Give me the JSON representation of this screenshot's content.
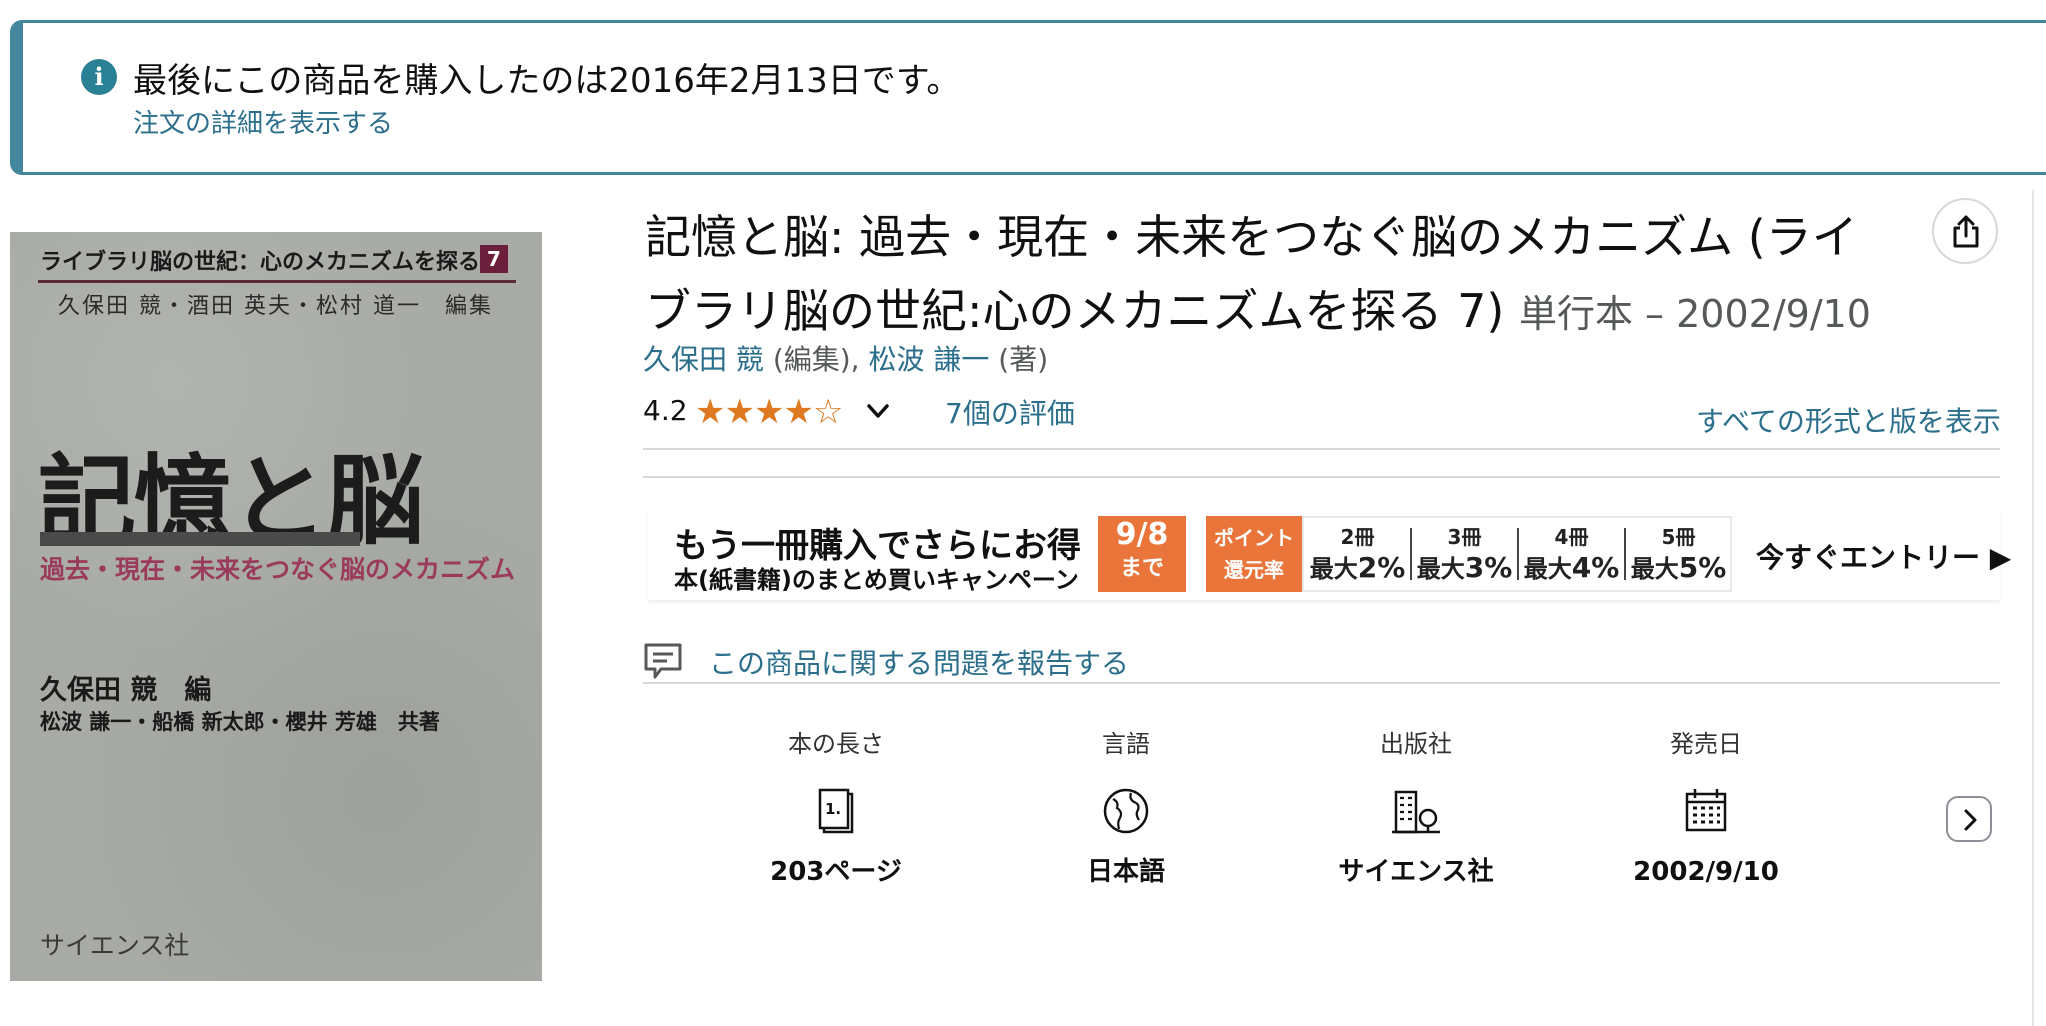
{
  "notice": {
    "icon": "info-icon",
    "message": "最後にこの商品を購入したのは2016年2月13日です。",
    "link": "注文の詳細を表示する"
  },
  "cover": {
    "series": "ライブラリ脳の世紀：心のメカニズムを探る",
    "volume": "7",
    "editors": "久保田 競・酒田 英夫・松村 道一　編集",
    "title": "記憶と脳",
    "subtitle": "過去・現在・未来をつなぐ脳のメカニズム",
    "author_main": "久保田 競　編",
    "author_co": "松波 謙一・船橋 新太郎・櫻井 芳雄　共著",
    "publisher": "サイエンス社"
  },
  "product": {
    "title": "記憶と脳: 過去・現在・未来をつなぐ脳のメカニズム (ライブラリ脳の世紀:心のメカニズムを探る 7)",
    "format": "単行本 – 2002/9/10",
    "contributors": [
      {
        "name": "久保田 競",
        "role": "(編集)",
        "sep": ", "
      },
      {
        "name": "松波 謙一",
        "role": "(著)",
        "sep": ""
      }
    ],
    "rating_value": "4.2",
    "rating_stars": 4.2,
    "rating_count": "7個の評価",
    "all_formats": "すべての形式と版を表示",
    "report": "この商品に関する問題を報告する"
  },
  "banner": {
    "headline": "もう一冊購入でさらにお得",
    "subline": "本(紙書籍)のまとめ買いキャンペーン",
    "date": "9/8",
    "date_suffix": "まで",
    "point_line1": "ポイント",
    "point_line2": "還元率",
    "tiers": [
      {
        "count": "2冊",
        "prefix": "最大",
        "rate": "2%"
      },
      {
        "count": "3冊",
        "prefix": "最大",
        "rate": "3%"
      },
      {
        "count": "4冊",
        "prefix": "最大",
        "rate": "4%"
      },
      {
        "count": "5冊",
        "prefix": "最大",
        "rate": "5%"
      }
    ],
    "entry": "今すぐエントリー ▶"
  },
  "details": [
    {
      "label": "本の長さ",
      "icon": "book-pages-icon",
      "value": "203ページ"
    },
    {
      "label": "言語",
      "icon": "globe-icon",
      "value": "日本語"
    },
    {
      "label": "出版社",
      "icon": "building-icon",
      "value": "サイエンス社"
    },
    {
      "label": "発売日",
      "icon": "calendar-icon",
      "value": "2002/9/10"
    }
  ],
  "colors": {
    "notice_border": "#44879c",
    "link": "#2b6f8c",
    "star": "#de7921",
    "banner_orange": "#e9753b"
  }
}
